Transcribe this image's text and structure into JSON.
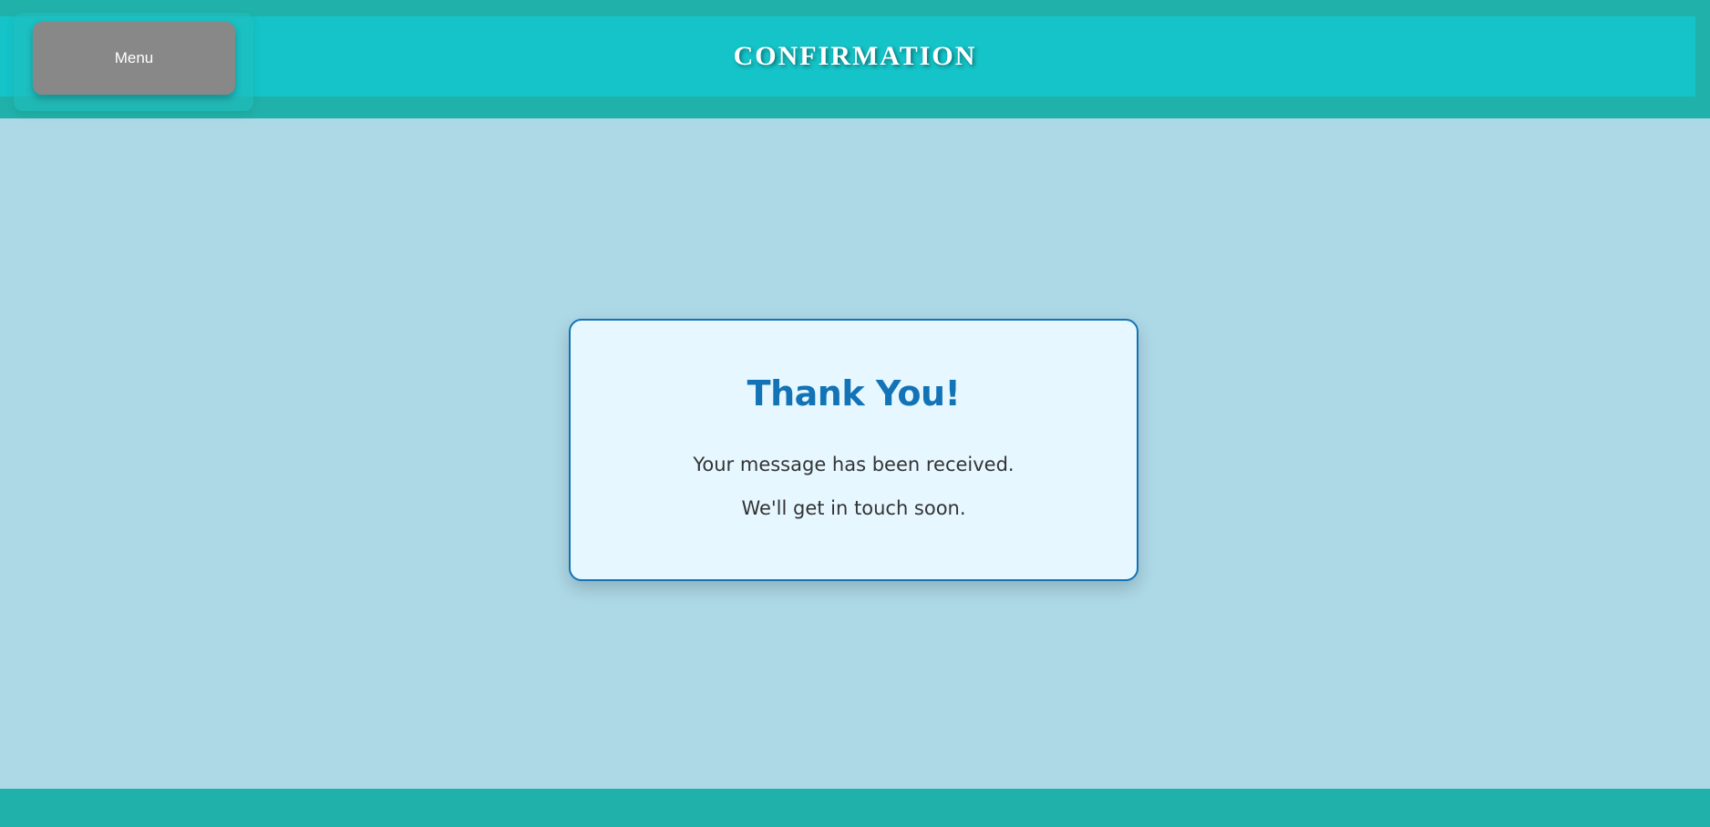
{
  "header": {
    "menu_label": "Menu",
    "title": "CONFIRMATION"
  },
  "card": {
    "title": "Thank You!",
    "lines": [
      "Your message has been received.",
      "We'll get in touch soon."
    ]
  },
  "colors": {
    "page_background": "#add8e6",
    "header_outer": "#20b2aa",
    "header_inner": "#14c4c8",
    "menu_button": "#888888",
    "card_background": "#e6f7ff",
    "card_accent": "#1273b6",
    "body_text": "#333333",
    "footer": "#20b2aa"
  }
}
